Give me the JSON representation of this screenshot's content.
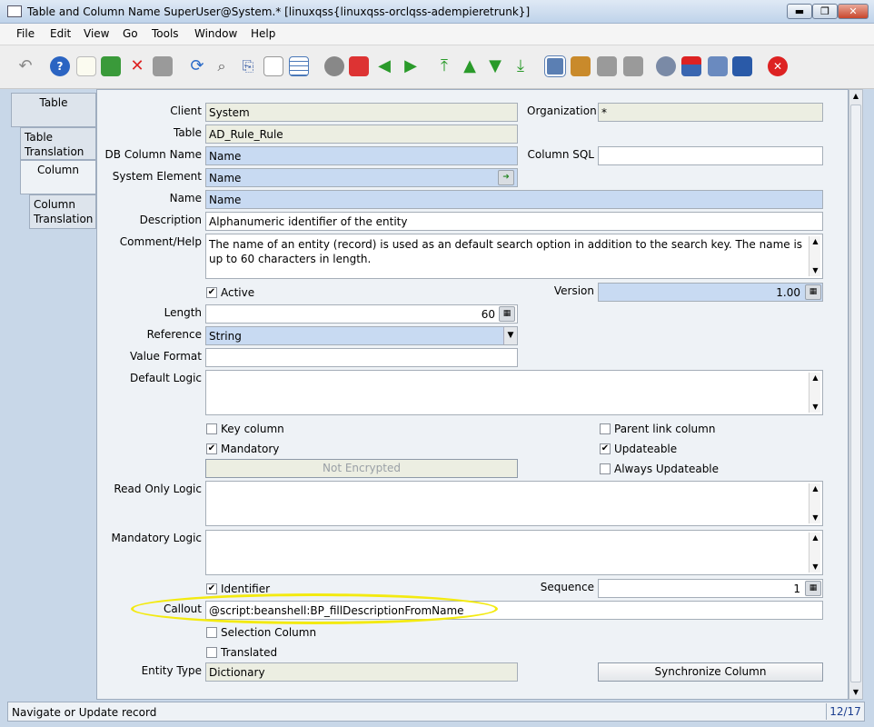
{
  "window": {
    "title": "Table and Column  Name  SuperUser@System.* [linuxqss{linuxqss-orclqss-adempieretrunk}]",
    "min_glyph": "▬",
    "max_glyph": "❐",
    "close_glyph": "✕"
  },
  "menu": [
    {
      "label": "File"
    },
    {
      "label": "Edit"
    },
    {
      "label": "View"
    },
    {
      "label": "Go"
    },
    {
      "label": "Tools"
    },
    {
      "label": "Window"
    },
    {
      "label": "Help"
    }
  ],
  "toolbar": {
    "icons": [
      "undo-icon",
      "help-icon",
      "new-record-icon",
      "copy-record-icon",
      "delete-icon",
      "save-icon",
      "refresh-icon",
      "find-icon",
      "attachment-icon",
      "chat-icon",
      "grid-toggle-icon",
      "history-icon",
      "home-icon",
      "back-icon",
      "forward-icon",
      "first-record-icon",
      "previous-record-icon",
      "next-record-icon",
      "last-record-icon",
      "report-icon",
      "archive-icon",
      "print-preview-icon",
      "print-icon",
      "zoom-across-icon",
      "active-workflows-icon",
      "requests-icon",
      "product-info-icon",
      "end-window-icon"
    ]
  },
  "tabs": [
    {
      "label": "Table",
      "selected": false
    },
    {
      "label": "Table Translation",
      "selected": false
    },
    {
      "label": "Column",
      "selected": true
    },
    {
      "label": "Column Translation",
      "selected": false
    }
  ],
  "form": {
    "client": {
      "label": "Client",
      "value": "System"
    },
    "organization": {
      "label": "Organization",
      "value": "*"
    },
    "table": {
      "label": "Table",
      "value": "AD_Rule_Rule"
    },
    "db_column_name": {
      "label": "DB Column Name",
      "value": "Name"
    },
    "column_sql": {
      "label": "Column SQL",
      "value": ""
    },
    "system_element": {
      "label": "System Element",
      "value": "Name"
    },
    "name": {
      "label": "Name",
      "value": "Name"
    },
    "description": {
      "label": "Description",
      "value": "Alphanumeric identifier of the entity"
    },
    "comment_help": {
      "label": "Comment/Help",
      "value": "The name of an entity (record) is used as an default search option in addition to the search key. The name is up to 60 characters in length."
    },
    "active": {
      "label": "Active",
      "checked": true
    },
    "version": {
      "label": "Version",
      "value": "1.00"
    },
    "length": {
      "label": "Length",
      "value": "60"
    },
    "reference": {
      "label": "Reference",
      "value": "String"
    },
    "value_format": {
      "label": "Value Format",
      "value": ""
    },
    "default_logic": {
      "label": "Default Logic",
      "value": ""
    },
    "key_column": {
      "label": "Key column",
      "checked": false
    },
    "parent_link_column": {
      "label": "Parent link column",
      "checked": false
    },
    "mandatory": {
      "label": "Mandatory",
      "checked": true
    },
    "updateable": {
      "label": "Updateable",
      "checked": true
    },
    "encryption_button": {
      "label": "Not Encrypted"
    },
    "always_updateable": {
      "label": "Always Updateable",
      "checked": false
    },
    "read_only_logic": {
      "label": "Read Only Logic",
      "value": ""
    },
    "mandatory_logic": {
      "label": "Mandatory Logic",
      "value": ""
    },
    "identifier": {
      "label": "Identifier",
      "checked": true
    },
    "sequence": {
      "label": "Sequence",
      "value": "1"
    },
    "callout": {
      "label": "Callout",
      "value": "@script:beanshell:BP_fillDescriptionFromName"
    },
    "selection_column": {
      "label": "Selection Column",
      "checked": false
    },
    "translated": {
      "label": "Translated",
      "checked": false
    },
    "entity_type": {
      "label": "Entity Type",
      "value": "Dictionary"
    },
    "synchronize_button": {
      "label": "Synchronize Column"
    }
  },
  "status": {
    "message": "Navigate or Update record",
    "record_position": "12/17"
  },
  "colors": {
    "highlight": "#fff200",
    "required": "#c8daf2",
    "readonly": "#eceee2"
  }
}
